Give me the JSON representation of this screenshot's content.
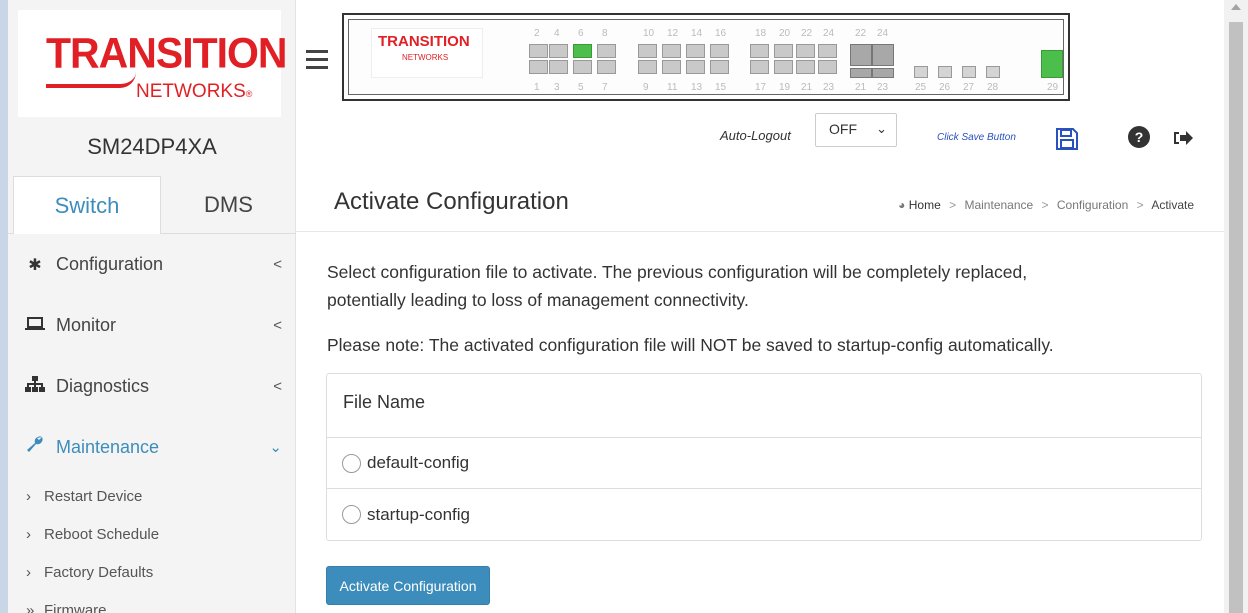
{
  "brand": {
    "logo_main": "TRANSITION",
    "logo_sub": "NETWORKS",
    "panel_logo_main": "TRANSITION",
    "panel_logo_sub": "NETWORKS"
  },
  "model": "SM24DP4XA",
  "tabs": [
    {
      "label": "Switch",
      "active": true
    },
    {
      "label": "DMS",
      "active": false
    }
  ],
  "sidebar": {
    "items": [
      {
        "label": "Configuration",
        "icon": "gear-icon",
        "expanded": false
      },
      {
        "label": "Monitor",
        "icon": "laptop-icon",
        "expanded": false
      },
      {
        "label": "Diagnostics",
        "icon": "sitemap-icon",
        "expanded": false
      },
      {
        "label": "Maintenance",
        "icon": "wrench-icon",
        "expanded": true
      }
    ],
    "subitems": [
      {
        "label": "Restart Device"
      },
      {
        "label": "Reboot Schedule"
      },
      {
        "label": "Factory Defaults"
      },
      {
        "label": "Firmware"
      }
    ]
  },
  "panel": {
    "top_numbers": [
      "2",
      "4",
      "6",
      "8",
      "10",
      "12",
      "14",
      "16",
      "18",
      "20",
      "22",
      "24",
      "22",
      "24"
    ],
    "bottom_numbers": [
      "1",
      "3",
      "5",
      "7",
      "9",
      "11",
      "13",
      "15",
      "17",
      "19",
      "21",
      "23",
      "21",
      "23",
      "25",
      "26",
      "27",
      "28",
      "29"
    ],
    "active_ports": [
      "6",
      "29"
    ]
  },
  "header": {
    "auto_logout_label": "Auto-Logout",
    "auto_logout_value": "OFF",
    "click_save_label": "Click Save Button",
    "icons": [
      "save-icon",
      "help-icon",
      "logout-icon"
    ]
  },
  "page": {
    "title": "Activate Configuration",
    "breadcrumb": [
      "Home",
      "Maintenance",
      "Configuration",
      "Activate"
    ],
    "description_1": "Select configuration file to activate. The previous configuration will be completely replaced,",
    "description_2": "potentially leading to loss of management connectivity.",
    "note": "Please note: The activated configuration file will NOT be saved to startup-config automatically.",
    "table_header": "File Name",
    "files": [
      {
        "name": "default-config"
      },
      {
        "name": "startup-config"
      }
    ],
    "button_label": "Activate Configuration"
  },
  "colors": {
    "accent": "#3c8dbc",
    "brand_red": "#e12026",
    "port_active": "#4cbe4c"
  }
}
